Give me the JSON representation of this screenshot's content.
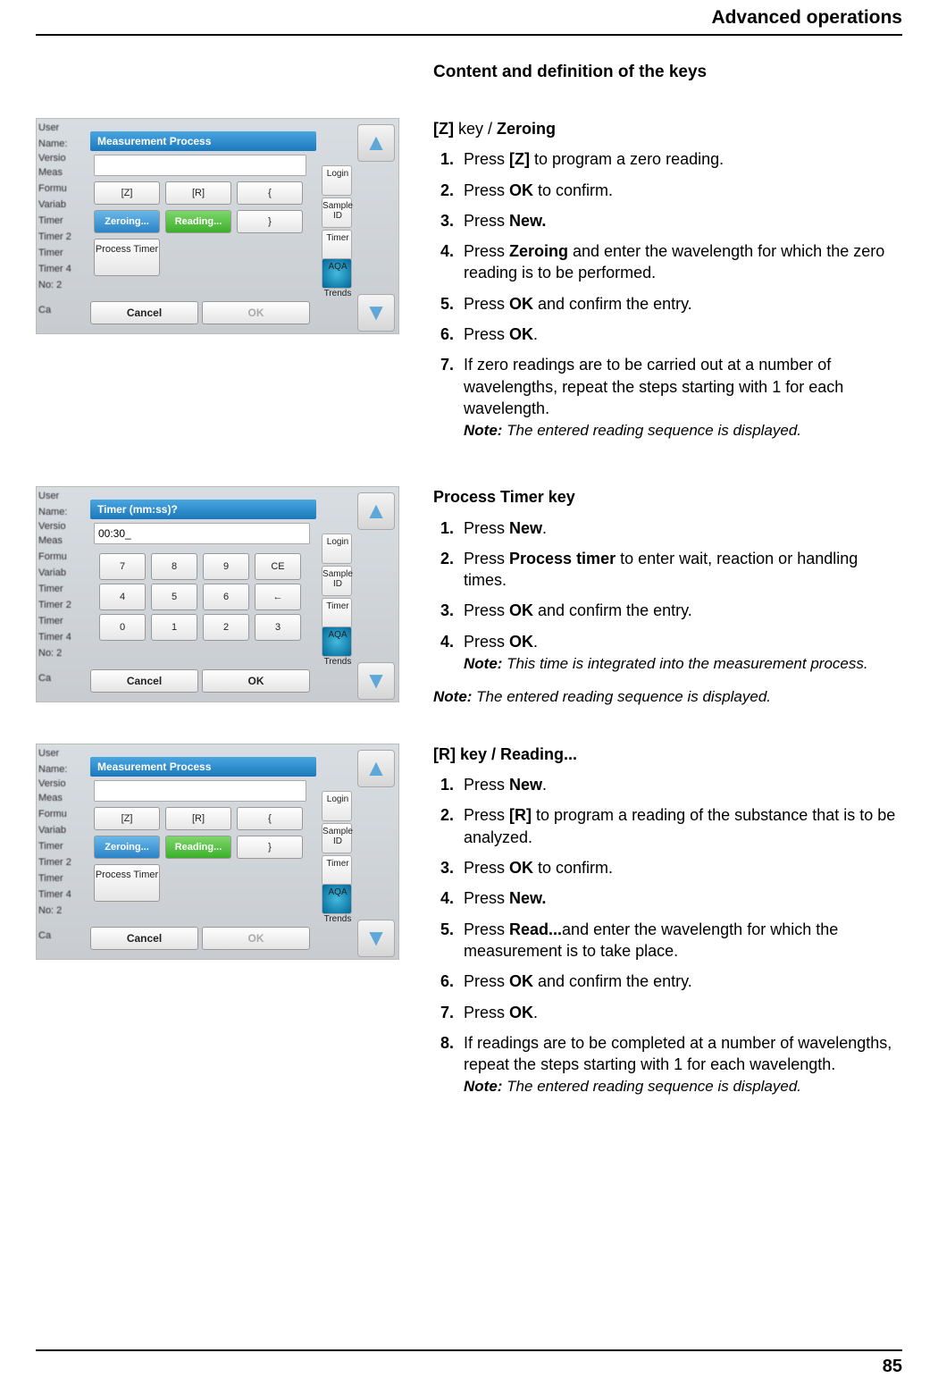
{
  "header": "Advanced operations",
  "sectionTitle": "Content and definition of the keys",
  "pageNumber": "85",
  "fig": {
    "sidebarLabels": [
      "User",
      "Name:",
      "Versio",
      "Meas",
      "Formu",
      "Variab",
      "Timer",
      "Timer 2",
      "Timer",
      "Timer 4",
      "No: 2",
      "Ca"
    ],
    "rightLabels": [
      "Login",
      "Sample ID",
      "Timer",
      "AQA",
      "Trends"
    ],
    "measProcess": {
      "title": "Measurement Process",
      "topRow": [
        "[Z]",
        "[R]",
        "{"
      ],
      "midRow": [
        "Zeroing...",
        "Reading...",
        "}"
      ],
      "lowBtn": "Process Timer",
      "cancel": "Cancel",
      "ok": "OK"
    },
    "timer": {
      "title": "Timer (mm:ss)?",
      "value": "00:30_",
      "keys": [
        [
          "7",
          "8",
          "9",
          "CE"
        ],
        [
          "4",
          "5",
          "6",
          "←"
        ],
        [
          "0",
          "1",
          "2",
          "3"
        ]
      ],
      "cancel": "Cancel",
      "ok": "OK"
    }
  },
  "sec1": {
    "titleA": "[Z]",
    "titleB": " key / ",
    "titleC": "Zeroing",
    "s1a": "Press  ",
    "s1b": "[Z]",
    "s1c": "  to program a zero reading.",
    "s2a": "Press ",
    "s2b": "OK",
    "s2c": " to confirm.",
    "s3a": "Press ",
    "s3b": "New.",
    "s4a": "Press ",
    "s4b": "Zeroing",
    "s4c": " and enter the wavelength for which the zero reading is to be performed.",
    "s5a": "Press ",
    "s5b": "OK",
    "s5c": " and confirm the entry.",
    "s6a": "Press ",
    "s6b": "OK",
    "s6c": ".",
    "s7": "If zero readings are to be carried out at a number of wavelengths, repeat the steps starting with 1 for each wavelength.",
    "noteLabel": "Note:",
    "note": " The entered reading sequence is displayed."
  },
  "sec2": {
    "title": "Process Timer key",
    "s1a": "Press ",
    "s1b": "New",
    "s1c": ".",
    "s2a": "Press ",
    "s2b": "Process timer",
    "s2c": " to enter wait, reaction or handling times.",
    "s3a": "Press ",
    "s3b": "OK",
    "s3c": " and confirm the entry.",
    "s4a": "Press ",
    "s4b": "OK",
    "s4c": ".",
    "note1Label": "Note:",
    "note1": " This time is integrated into the measurement process.",
    "note2Label": "Note:",
    "note2": " The entered reading sequence is displayed."
  },
  "sec3": {
    "title": "[R] key / Reading...",
    "s1a": "Press ",
    "s1b": "New",
    "s1c": ".",
    "s2a": "Press  ",
    "s2b": "[R]",
    "s2c": "  to program a reading of the substance that is to be analyzed.",
    "s3a": "Press ",
    "s3b": "OK",
    "s3c": " to confirm.",
    "s4a": "Press ",
    "s4b": "New.",
    "s5a": "Press ",
    "s5b": "Read...",
    "s5c": "and enter the wavelength for which the measurement is to take place.",
    "s6a": "Press ",
    "s6b": "OK",
    "s6c": " and confirm the entry.",
    "s7a": "Press ",
    "s7b": "OK",
    "s7c": ".",
    "s8": "If readings are to be completed at a number of wavelengths, repeat the steps starting with 1 for each wavelength.",
    "noteLabel": "Note:",
    "note": " The entered reading sequence is displayed."
  }
}
